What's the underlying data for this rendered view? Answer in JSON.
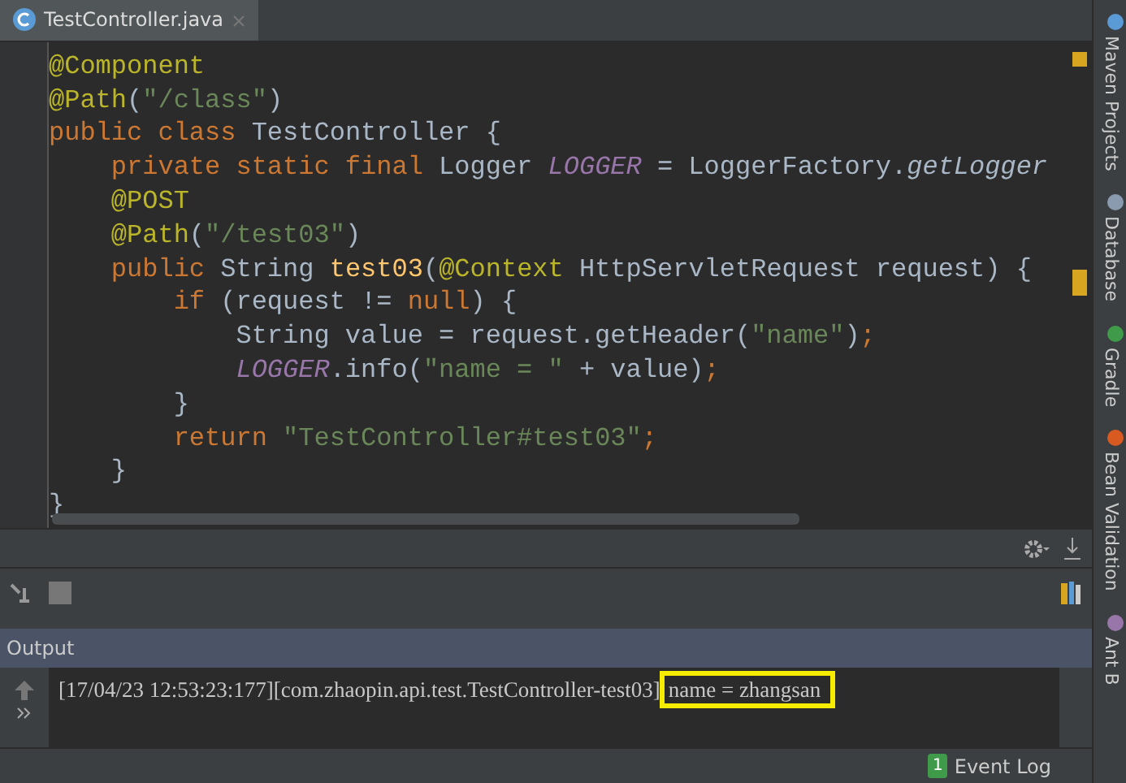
{
  "tabs": [
    {
      "label": "TestController.java",
      "selected": true
    }
  ],
  "code_lines": [
    [
      {
        "kind": "annotation",
        "text": "@Component"
      }
    ],
    [
      {
        "kind": "annotation",
        "text": "@Path"
      },
      {
        "kind": "plain",
        "text": "("
      },
      {
        "kind": "string",
        "text": "\"/class\""
      },
      {
        "kind": "plain",
        "text": ")"
      }
    ],
    [
      {
        "kind": "keyword",
        "text": "public class "
      },
      {
        "kind": "plain",
        "text": "TestController {"
      }
    ],
    [
      {
        "kind": "keyword",
        "text": "    private static final "
      },
      {
        "kind": "plain",
        "text": "Logger "
      },
      {
        "kind": "field",
        "text": "LOGGER"
      },
      {
        "kind": "plain",
        "text": " = LoggerFactory."
      },
      {
        "kind": "italic",
        "text": "getLogger"
      }
    ],
    [
      {
        "kind": "annotation",
        "text": "    @POST"
      }
    ],
    [
      {
        "kind": "annotation",
        "text": "    @Path"
      },
      {
        "kind": "plain",
        "text": "("
      },
      {
        "kind": "string",
        "text": "\"/test03\""
      },
      {
        "kind": "plain",
        "text": ")"
      }
    ],
    [
      {
        "kind": "keyword",
        "text": "    public "
      },
      {
        "kind": "plain",
        "text": "String "
      },
      {
        "kind": "method",
        "text": "test03"
      },
      {
        "kind": "plain",
        "text": "("
      },
      {
        "kind": "annotation",
        "text": "@Context"
      },
      {
        "kind": "plain",
        "text": " HttpServletRequest request) {"
      }
    ],
    [
      {
        "kind": "keyword",
        "text": "        if "
      },
      {
        "kind": "plain",
        "text": "(request != "
      },
      {
        "kind": "keyword",
        "text": "null"
      },
      {
        "kind": "plain",
        "text": ") {"
      }
    ],
    [
      {
        "kind": "plain",
        "text": "            String value = request.getHeader("
      },
      {
        "kind": "string",
        "text": "\"name\""
      },
      {
        "kind": "plain",
        "text": ")"
      },
      {
        "kind": "keyword",
        "text": ";"
      }
    ],
    [
      {
        "kind": "field",
        "text": "            LOGGER"
      },
      {
        "kind": "plain",
        "text": ".info("
      },
      {
        "kind": "string",
        "text": "\"name = \""
      },
      {
        "kind": "plain",
        "text": " + value)"
      },
      {
        "kind": "keyword",
        "text": ";"
      }
    ],
    [
      {
        "kind": "plain",
        "text": "        }"
      }
    ],
    [
      {
        "kind": "keyword",
        "text": "        return "
      },
      {
        "kind": "string",
        "text": "\"TestController#test03\""
      },
      {
        "kind": "keyword",
        "text": ";"
      }
    ],
    [
      {
        "kind": "plain",
        "text": "    }"
      }
    ],
    [
      {
        "kind": "plain",
        "text": "}"
      }
    ]
  ],
  "output": {
    "title": "Output",
    "log": [
      {
        "text": "[17/04/23 12:53:23:177][com.zhaopin.api.test.TestController-test03]",
        "highlighted": false
      },
      {
        "text": "name = zhangsan",
        "highlighted": true
      }
    ]
  },
  "status_bar": {
    "badge": "1",
    "label": "Event Log"
  },
  "side_tools": [
    "Maven Projects",
    "Database",
    "Gradle",
    "Bean Validation",
    "Ant B"
  ]
}
